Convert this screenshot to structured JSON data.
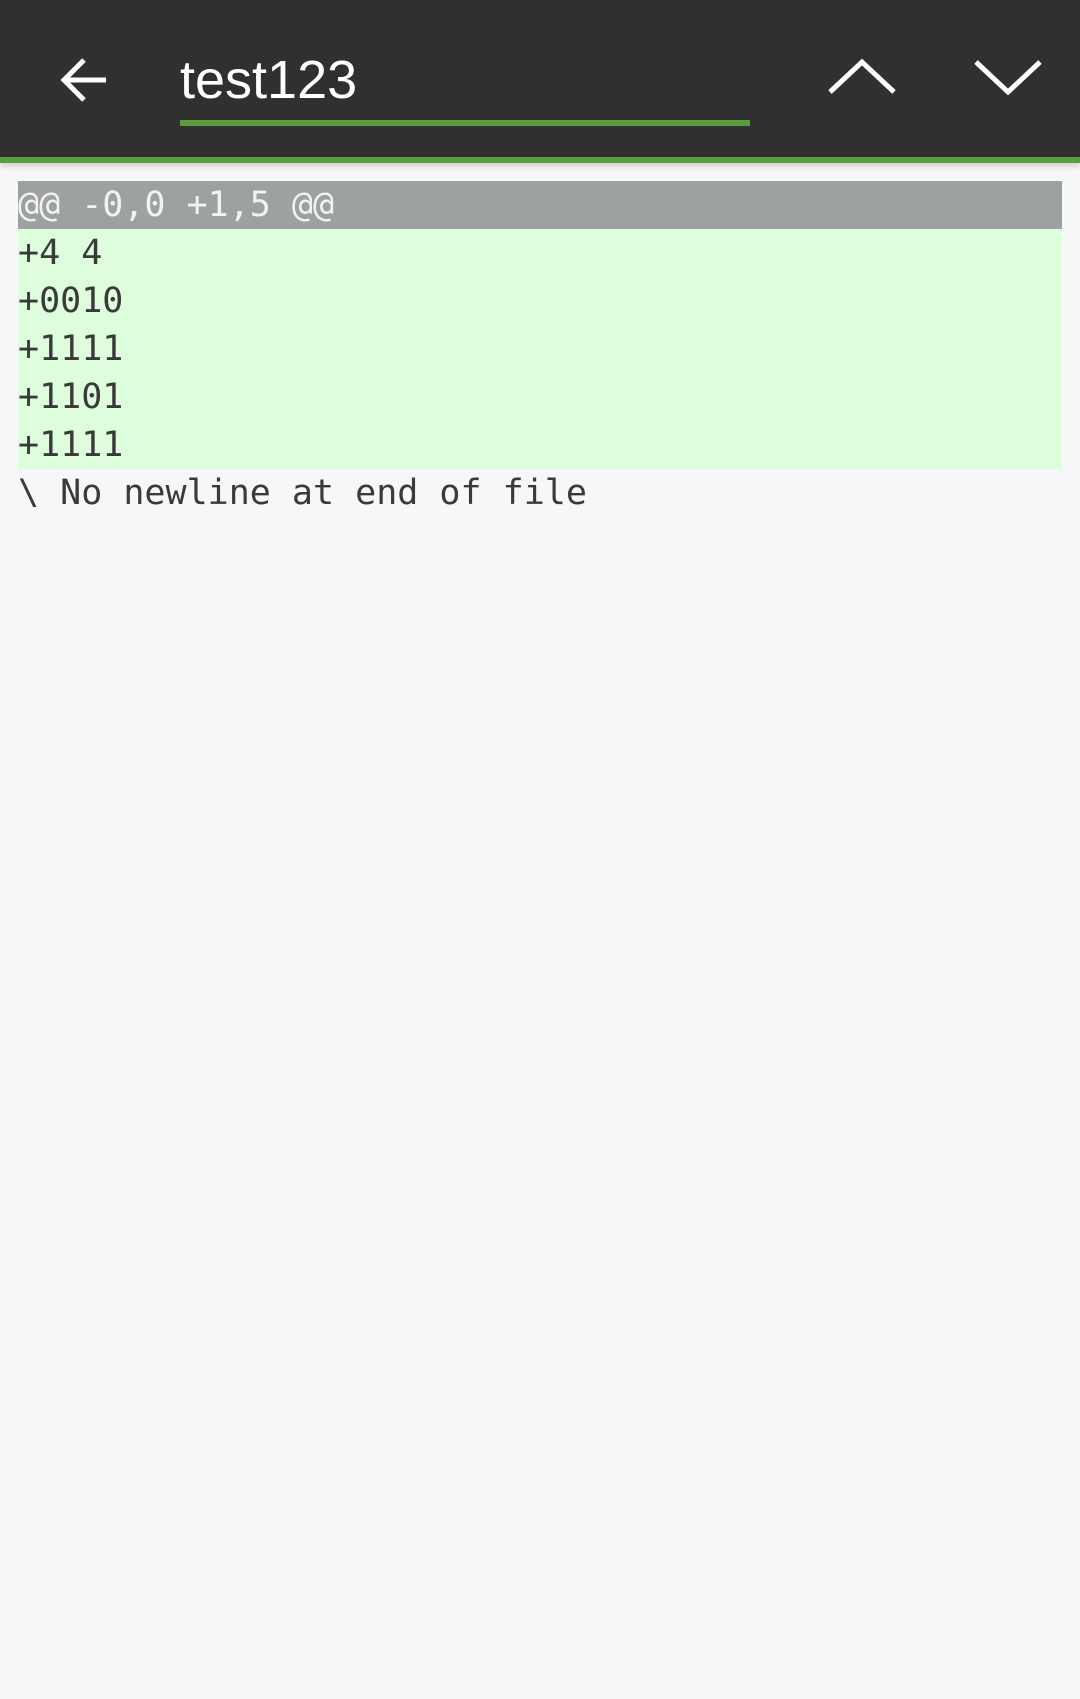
{
  "search": {
    "value": "test123"
  },
  "colors": {
    "toolbar": "#303030",
    "accent": "#589c3c",
    "hunk_bg": "#9ea1a2",
    "added_bg": "#ddfddd"
  },
  "icons": {
    "back": "arrow-left-icon",
    "prev": "chevron-up-icon",
    "next": "chevron-down-icon"
  },
  "diff": {
    "hunk_header": "@@ -0,0 +1,5 @@",
    "added_lines": [
      "+4 4",
      "+0010",
      "+1111",
      "+1101",
      "+1111"
    ],
    "footer": "\\ No newline at end of file"
  }
}
